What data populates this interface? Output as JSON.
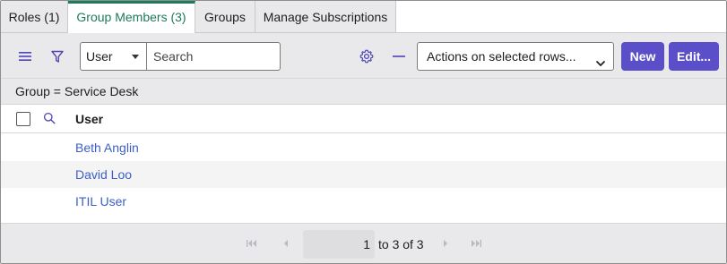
{
  "tabs": [
    {
      "label": "Roles (1)"
    },
    {
      "label": "Group Members (3)"
    },
    {
      "label": "Groups"
    },
    {
      "label": "Manage Subscriptions"
    }
  ],
  "toolbar": {
    "field_select_value": "User",
    "search_placeholder": "Search",
    "actions_value": "Actions on selected rows...",
    "new_label": "New",
    "edit_label": "Edit..."
  },
  "filter": {
    "breadcrumb": "Group = Service Desk"
  },
  "table": {
    "columns": [
      {
        "label": "User"
      }
    ],
    "rows": [
      {
        "user": "Beth Anglin"
      },
      {
        "user": "David Loo"
      },
      {
        "user": "ITIL User"
      }
    ]
  },
  "pagination": {
    "current_page": "1",
    "range_text": "to 3 of 3"
  },
  "colors": {
    "accent_tab": "#1f7a5a",
    "button": "#5a4fc8",
    "link": "#3b5fc4",
    "icon": "#4f46b5"
  },
  "icons": [
    "hamburger-menu-icon",
    "filter-funnel-icon",
    "gear-icon",
    "minus-icon",
    "search-icon",
    "first-page-icon",
    "previous-page-icon",
    "next-page-icon",
    "last-page-icon"
  ]
}
